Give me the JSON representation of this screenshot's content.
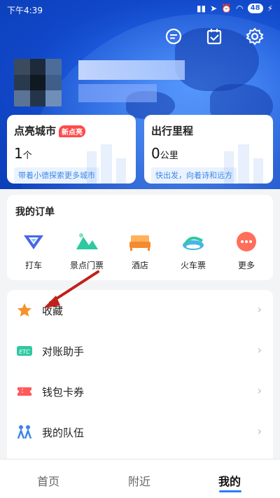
{
  "status_bar": {
    "time": "下午4:39",
    "battery": "48"
  },
  "profile": {
    "avatar": "user-avatar",
    "name_hidden": true
  },
  "stats": [
    {
      "title": "点亮城市",
      "badge": "新点亮",
      "value": "1",
      "unit": "个",
      "tag": "带着小德探索更多城市"
    },
    {
      "title": "出行里程",
      "value": "0",
      "unit": "公里",
      "tag": "快出发，向着诗和远方"
    }
  ],
  "orders": {
    "title": "我的订单",
    "items": [
      {
        "label": "打车",
        "icon": "taxi-icon"
      },
      {
        "label": "景点门票",
        "icon": "scenic-ticket-icon"
      },
      {
        "label": "酒店",
        "icon": "hotel-icon"
      },
      {
        "label": "火车票",
        "icon": "train-ticket-icon"
      },
      {
        "label": "更多",
        "icon": "more-icon"
      }
    ]
  },
  "menu": [
    {
      "label": "收藏",
      "icon": "star-icon"
    },
    {
      "label": "对账助手",
      "icon": "etc-icon"
    },
    {
      "label": "钱包卡券",
      "icon": "wallet-icon"
    },
    {
      "label": "我的队伍",
      "icon": "team-icon"
    }
  ],
  "tabs": [
    {
      "label": "首页"
    },
    {
      "label": "附近"
    },
    {
      "label": "我的",
      "active": true
    }
  ],
  "colors": {
    "brand_blue": "#1f5fe0",
    "accent_red": "#ff4a4a",
    "tag_blue": "#3d86e6",
    "star_orange": "#f5922a"
  }
}
